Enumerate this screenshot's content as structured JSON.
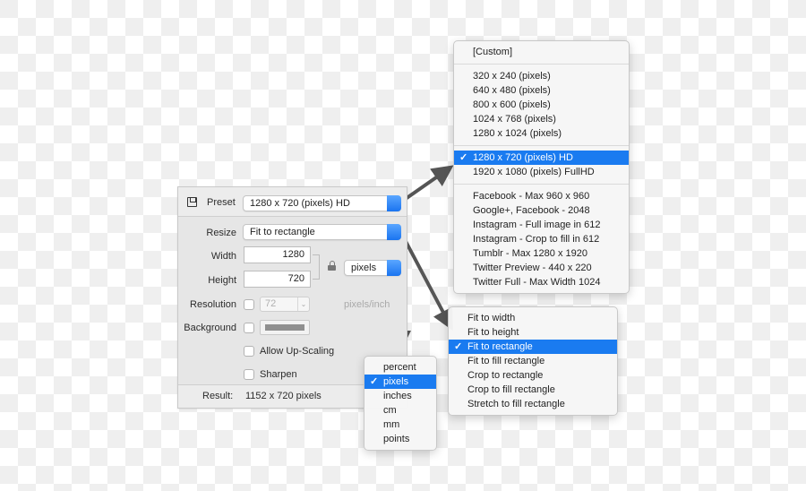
{
  "panel": {
    "preset": {
      "label": "Preset",
      "value": "1280 x 720 (pixels) HD",
      "icon": "save-icon"
    },
    "resize": {
      "label": "Resize",
      "value": "Fit to rectangle"
    },
    "width": {
      "label": "Width",
      "value": "1280"
    },
    "height": {
      "label": "Height",
      "value": "720"
    },
    "lock_icon": "lock-icon",
    "unit": {
      "value": "pixels"
    },
    "resolution": {
      "label": "Resolution",
      "checked": false,
      "value": "72",
      "unit_label": "pixels/inch"
    },
    "background": {
      "label": "Background",
      "checked": false,
      "color": "#8f8f8f"
    },
    "allow_upscaling": {
      "label": "Allow Up-Scaling",
      "checked": false
    },
    "sharpen": {
      "label": "Sharpen",
      "checked": false
    },
    "result": {
      "label": "Result:",
      "value": "1152 x 720 pixels"
    }
  },
  "preset_menu": {
    "groups": [
      [
        "[Custom]"
      ],
      [
        "320 x 240 (pixels)",
        "640 x 480 (pixels)",
        "800 x 600 (pixels)",
        "1024 x 768 (pixels)",
        "1280 x 1024 (pixels)"
      ],
      [
        "1280 x 720 (pixels) HD",
        "1920 x 1080 (pixels) FullHD"
      ],
      [
        "Facebook - Max 960 x 960",
        "Google+, Facebook - 2048",
        "Instagram - Full image in 612",
        "Instagram - Crop to fill in 612",
        "Tumblr - Max 1280 x 1920",
        "Twitter Preview - 440 x 220",
        "Twitter Full - Max Width 1024"
      ]
    ],
    "selected": "1280 x 720 (pixels) HD"
  },
  "resize_menu": {
    "items": [
      "Fit to width",
      "Fit to height",
      "Fit to rectangle",
      "Fit to fill rectangle",
      "Crop to rectangle",
      "Crop to fill rectangle",
      "Stretch to fill rectangle"
    ],
    "selected": "Fit to rectangle"
  },
  "unit_menu": {
    "items": [
      "percent",
      "pixels",
      "inches",
      "cm",
      "mm",
      "points"
    ],
    "selected": "pixels"
  },
  "check_glyph": "✓",
  "colors": {
    "accent": "#1a7bf0",
    "arrow": "#555555"
  }
}
